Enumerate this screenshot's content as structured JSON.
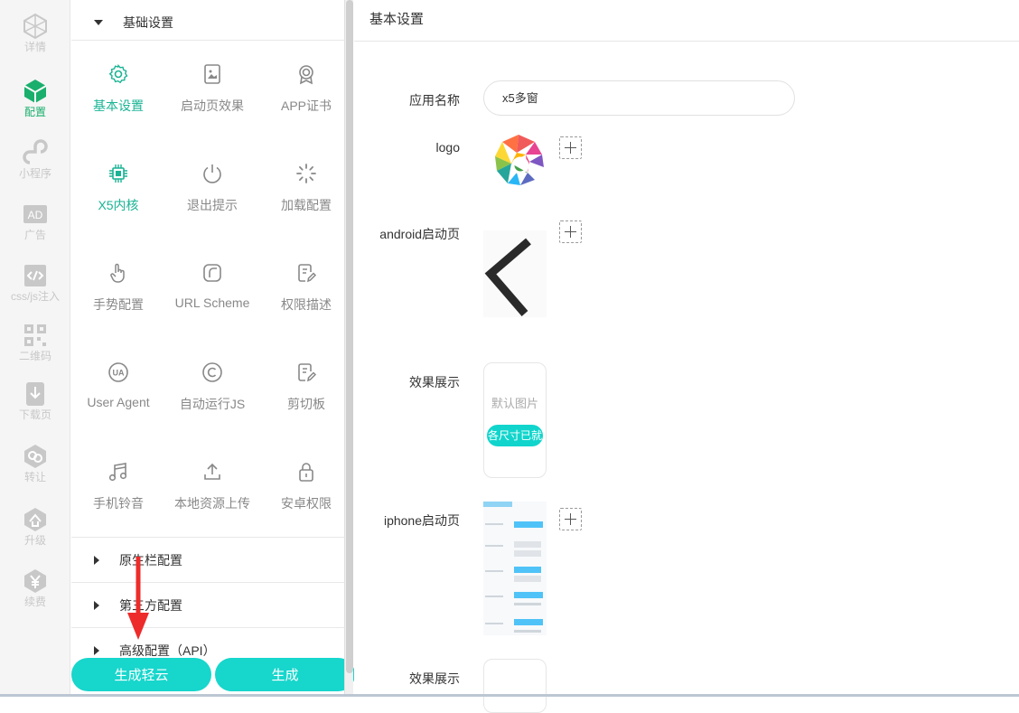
{
  "rail": [
    {
      "label": "详情",
      "icon": "cube-outline-icon"
    },
    {
      "label": "配置",
      "icon": "cube-filled-icon",
      "active": true
    },
    {
      "label": "小程序",
      "icon": "mini-program-icon"
    },
    {
      "label": "广告",
      "icon": "ad-icon"
    },
    {
      "label": "css/js注入",
      "icon": "code-inject-icon"
    },
    {
      "label": "二维码",
      "icon": "qr-code-icon"
    },
    {
      "label": "下载页",
      "icon": "download-page-icon"
    },
    {
      "label": "转让",
      "icon": "transfer-icon"
    },
    {
      "label": "升级",
      "icon": "upgrade-icon"
    },
    {
      "label": "续费",
      "icon": "renew-yen-icon"
    }
  ],
  "menu": {
    "basic_section": "基础设置",
    "tiles": [
      {
        "label": "基本设置",
        "icon": "gear-icon",
        "active": true
      },
      {
        "label": "启动页效果",
        "icon": "launch-screen-icon"
      },
      {
        "label": "APP证书",
        "icon": "certificate-icon"
      },
      {
        "label": "X5内核",
        "icon": "chip-icon",
        "active": true
      },
      {
        "label": "退出提示",
        "icon": "power-icon"
      },
      {
        "label": "加载配置",
        "icon": "loading-spinner-icon"
      },
      {
        "label": "手势配置",
        "icon": "hand-gesture-icon"
      },
      {
        "label": "URL Scheme",
        "icon": "url-scheme-icon"
      },
      {
        "label": "权限描述",
        "icon": "edit-document-icon"
      },
      {
        "label": "User Agent",
        "icon": "ua-icon"
      },
      {
        "label": "自动运行JS",
        "icon": "copyright-c-icon"
      },
      {
        "label": "剪切板",
        "icon": "clipboard-edit-icon"
      },
      {
        "label": "手机铃音",
        "icon": "music-note-icon"
      },
      {
        "label": "本地资源上传",
        "icon": "upload-icon"
      },
      {
        "label": "安卓权限",
        "icon": "lock-icon"
      }
    ],
    "sections": [
      "原生栏配置",
      "第三方配置",
      "高级配置（API）"
    ]
  },
  "buttons": {
    "cloud": "生成轻云",
    "generate": "生成"
  },
  "main": {
    "title": "基本设置",
    "app_name_label": "应用名称",
    "app_name_value": "x5多窗",
    "logo_label": "logo",
    "android_label": "android启动页",
    "effect_label_1": "效果展示",
    "preview_default_text": "默认图片",
    "preview_button_text": "各尺寸已就",
    "iphone_label": "iphone启动页",
    "effect_label_2": "效果展示"
  },
  "colors": {
    "accent_green": "#1aaf6d",
    "teal": "#17d6cc",
    "annotation_red": "#ee2b2b"
  }
}
